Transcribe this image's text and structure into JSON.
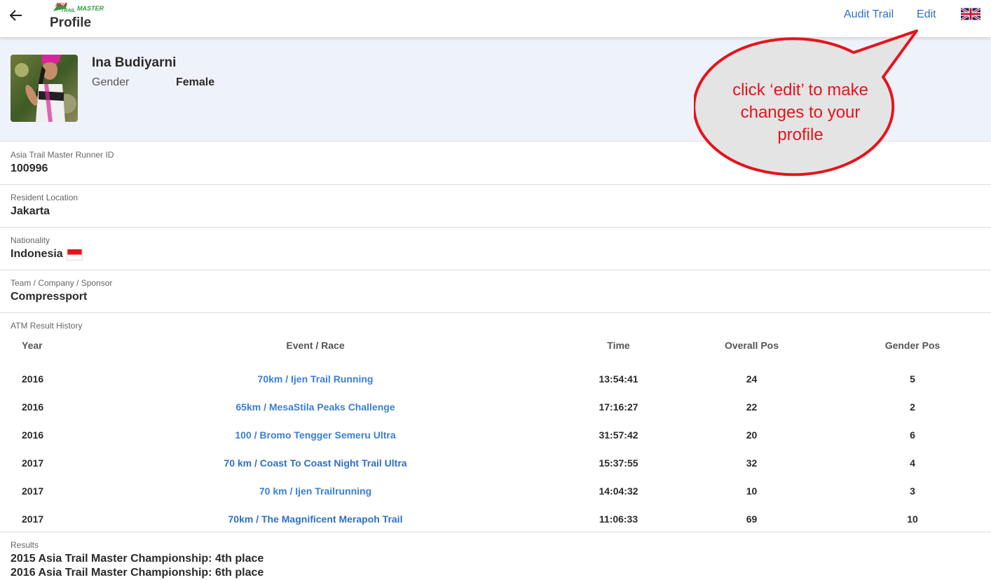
{
  "header": {
    "title": "Profile",
    "logo": {
      "icon": "asia-trail-master-logo",
      "line1": "ASIA",
      "line2": "TRAIL",
      "line3": "MASTER"
    },
    "audit_trail": "Audit Trail",
    "edit": "Edit",
    "language_flag": "uk-flag-icon"
  },
  "profile": {
    "name": "Ina Budiyarni",
    "gender_label": "Gender",
    "gender_value": "Female"
  },
  "fields": {
    "runner_id": {
      "label": "Asia Trail Master Runner ID",
      "value": "100996"
    },
    "location": {
      "label": "Resident Location",
      "value": "Jakarta"
    },
    "nationality": {
      "label": "Nationality",
      "value": "Indonesia",
      "flag": "indonesia-flag-icon"
    },
    "team": {
      "label": "Team / Company / Sponsor",
      "value": "Compressport"
    }
  },
  "history": {
    "label": "ATM Result History",
    "columns": [
      "Year",
      "Event / Race",
      "Time",
      "Overall Pos",
      "Gender Pos"
    ],
    "rows": [
      {
        "year": "2016",
        "event": "70km / Ijen Trail Running",
        "time": "13:54:41",
        "overall": "24",
        "gender": "5"
      },
      {
        "year": "2016",
        "event": "65km / MesaStila Peaks Challenge",
        "time": "17:16:27",
        "overall": "22",
        "gender": "2"
      },
      {
        "year": "2016",
        "event": "100 / Bromo Tengger Semeru Ultra",
        "time": "31:57:42",
        "overall": "20",
        "gender": "6"
      },
      {
        "year": "2017",
        "event": "70 km / Coast To Coast Night Trail Ultra",
        "time": "15:37:55",
        "overall": "32",
        "gender": "4"
      },
      {
        "year": "2017",
        "event": "70 km / Ijen Trailrunning",
        "time": "14:04:32",
        "overall": "10",
        "gender": "3"
      },
      {
        "year": "2017",
        "event": "70km / The Magnificent Merapoh Trail",
        "time": "11:06:33",
        "overall": "69",
        "gender": "10"
      }
    ]
  },
  "results": {
    "label": "Results",
    "lines": [
      "2015 Asia Trail Master Championship: 4th place",
      "2016 Asia Trail Master Championship: 6th place"
    ]
  },
  "callout": {
    "text": "click ‘edit’ to make changes to your profile"
  },
  "colors": {
    "link": "#2f6fc4",
    "event_link": "#3a7fd5",
    "profile_band": "#eef3fb",
    "callout_border": "#e5141c",
    "callout_fill": "#e4e4e4"
  }
}
